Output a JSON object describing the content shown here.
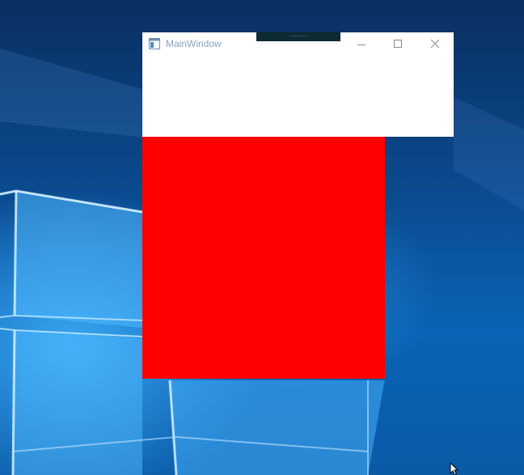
{
  "desktop": {
    "wallpaper": "windows-10-hero"
  },
  "window": {
    "title": "MainWindow",
    "icon": "application-window-icon",
    "buttons": {
      "minimize_icon": "minimize-icon",
      "maximize_icon": "maximize-icon",
      "close_icon": "close-icon"
    }
  },
  "content": {
    "red_panel_color": "#ff0000"
  },
  "colors": {
    "title_text": "#8aa4be",
    "window_bg": "#ffffff",
    "drag_handle": "#0e2a33"
  }
}
